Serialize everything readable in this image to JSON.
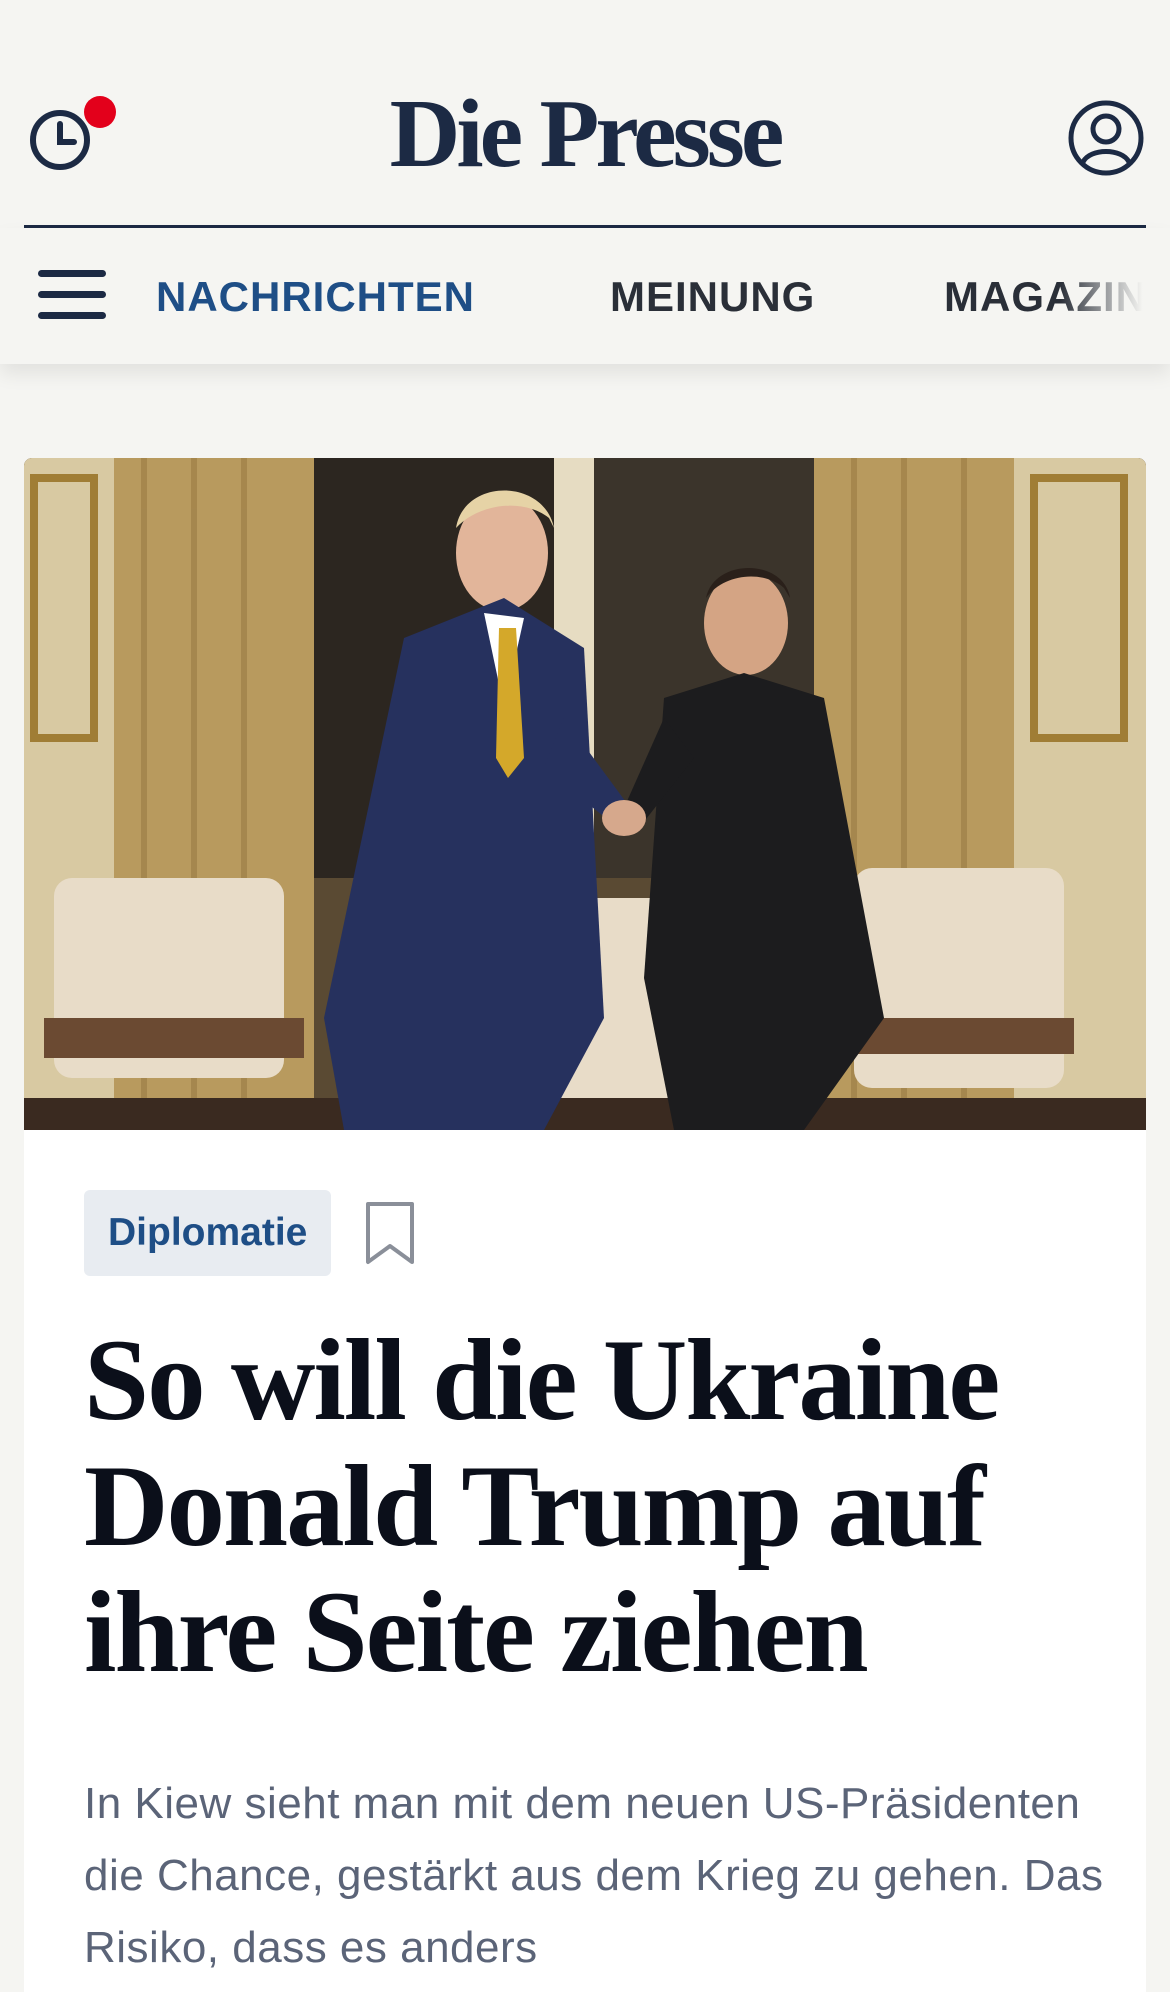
{
  "header": {
    "logo": "Die Presse"
  },
  "nav": {
    "items": [
      {
        "label": "NACHRICHTEN",
        "active": true
      },
      {
        "label": "MEINUNG",
        "active": false
      },
      {
        "label": "MAGAZIN",
        "active": false
      }
    ]
  },
  "article": {
    "tag": "Diplomatie",
    "headline": "So will die Ukraine Donald Trump auf ihre Seite ziehen",
    "lead": "In Kiew sieht man mit dem neuen US-Präsidenten die Chance, gestärkt aus dem Krieg zu gehen. Das Risiko, dass es anders"
  },
  "colors": {
    "brand": "#1c2a44",
    "accent": "#1e4e86",
    "notification": "#e3001b"
  },
  "icons": [
    "history-clock-icon",
    "account-icon",
    "hamburger-menu-icon",
    "bookmark-icon"
  ]
}
